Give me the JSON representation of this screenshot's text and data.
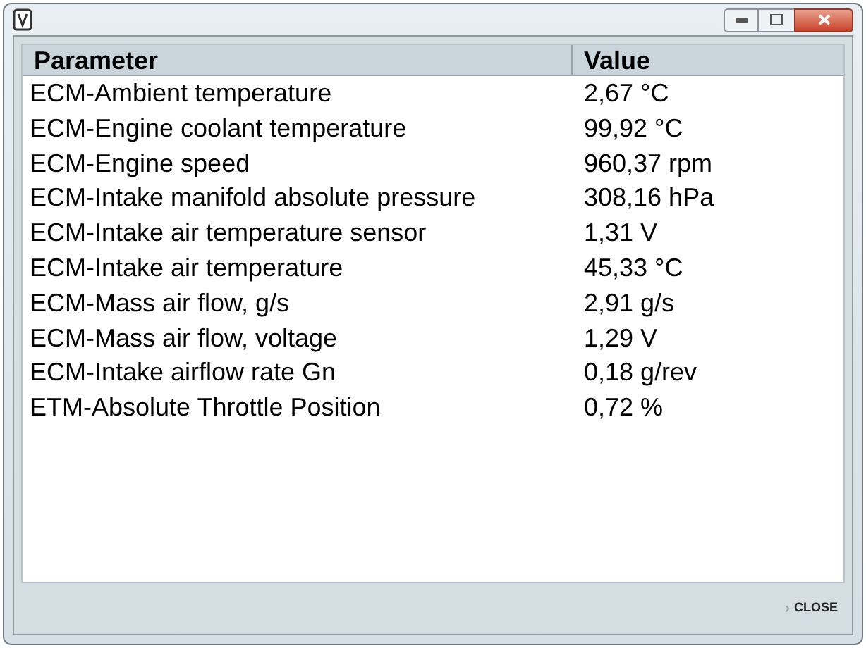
{
  "table": {
    "columns": [
      "Parameter",
      "Value"
    ],
    "rows": [
      [
        "ECM-Ambient temperature",
        "2,67 °C"
      ],
      [
        "ECM-Engine coolant temperature",
        "99,92 °C"
      ],
      [
        "ECM-Engine speed",
        "960,37 rpm"
      ],
      [
        "ECM-Intake manifold absolute pressure",
        "308,16 hPa"
      ],
      [
        "ECM-Intake air temperature sensor",
        "1,31 V"
      ],
      [
        "ECM-Intake air temperature",
        "45,33 °C"
      ],
      [
        "ECM-Mass air flow, g/s",
        "2,91 g/s"
      ],
      [
        "ECM-Mass air flow, voltage",
        "1,29 V"
      ],
      [
        "ECM-Intake airflow rate Gn",
        "0,18 g/rev"
      ],
      [
        "ETM-Absolute Throttle Position",
        "0,72 %"
      ]
    ]
  },
  "footer": {
    "close": "CLOSE",
    "close_icon": "›"
  }
}
